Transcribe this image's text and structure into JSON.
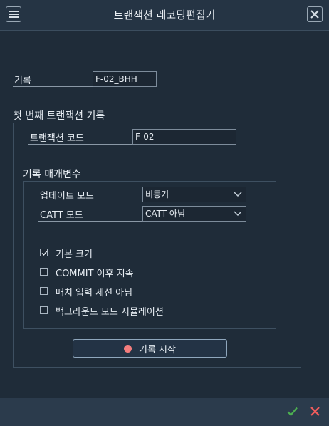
{
  "window": {
    "title": "트랜잭션 레코딩편집기"
  },
  "icons": {
    "menu": "hamburger-menu-icon",
    "close": "close-icon",
    "ok": "checkmark-icon",
    "cancel": "cross-icon",
    "record": "record-dot-icon",
    "dropdown": "chevron-down-icon"
  },
  "colors": {
    "background": "#1f2c39",
    "record_dot": "#f47d7d",
    "ok": "#4caf50",
    "cancel": "#f25c5c"
  },
  "recording": {
    "label": "기록",
    "value": "F-02_BHH"
  },
  "first_section": {
    "title": "첫 번째 트랜잭션 기록",
    "tcode_label": "트랜잭션 코드",
    "tcode_value": "F-02",
    "params_title": "기록 매개변수",
    "update_mode_label": "업데이트 모드",
    "update_mode_value": "비동기",
    "catt_mode_label": "CATT 모드",
    "catt_mode_value": "CATT 아님",
    "checkboxes": [
      {
        "label": "기본 크기",
        "checked": true
      },
      {
        "label": "COMMIT 이후 지속",
        "checked": false
      },
      {
        "label": "배치 입력 세션 아님",
        "checked": false
      },
      {
        "label": "백그라운드 모드 시뮬레이션",
        "checked": false
      }
    ]
  },
  "start_button": {
    "label": "기록 시작"
  }
}
